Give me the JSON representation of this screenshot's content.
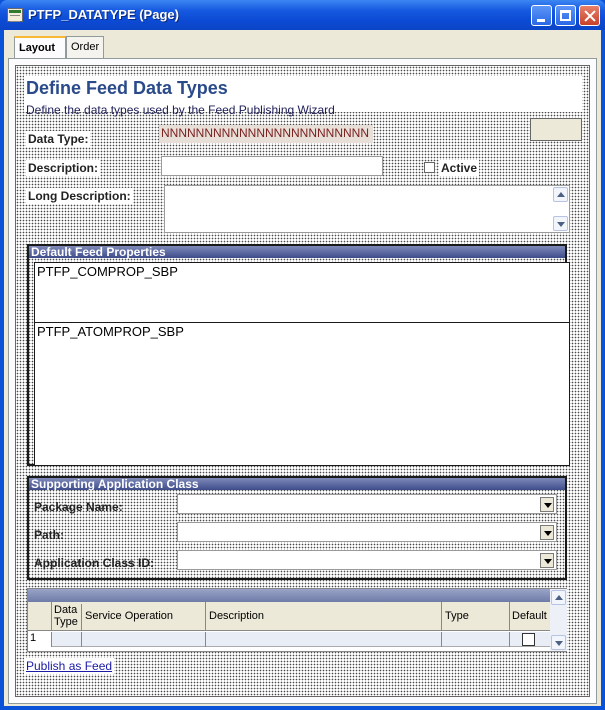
{
  "window": {
    "title": "PTFP_DATATYPE (Page)"
  },
  "tabs": [
    {
      "label": "Layout"
    },
    {
      "label": "Order"
    }
  ],
  "page": {
    "heading": "Define Feed Data Types",
    "instruction": "Define the data types used by the Feed Publishing Wizard"
  },
  "fields": {
    "data_type_label": "Data Type:",
    "data_type_value": "NNNNNNNNNNNNNNNNNNNNNNNN",
    "description_label": "Description:",
    "active_label": "Active",
    "long_description_label": "Long Description:"
  },
  "default_props": {
    "header": "Default Feed Properties",
    "subpage1": "PTFP_COMPROP_SBP",
    "subpage2": "PTFP_ATOMPROP_SBP"
  },
  "app_class": {
    "header": "Supporting Application Class",
    "package_label": "Package Name:",
    "path_label": "Path:",
    "class_id_label": "Application Class ID:"
  },
  "grid": {
    "columns": [
      "Data Type",
      "Service Operation",
      "Description",
      "Type",
      "Default"
    ],
    "row_number": "1"
  },
  "link": {
    "publish": "Publish as Feed"
  },
  "colors": {
    "titlebar": "#0b45c6",
    "group_header": "#3e4c8c",
    "link": "#1a1aa6"
  }
}
